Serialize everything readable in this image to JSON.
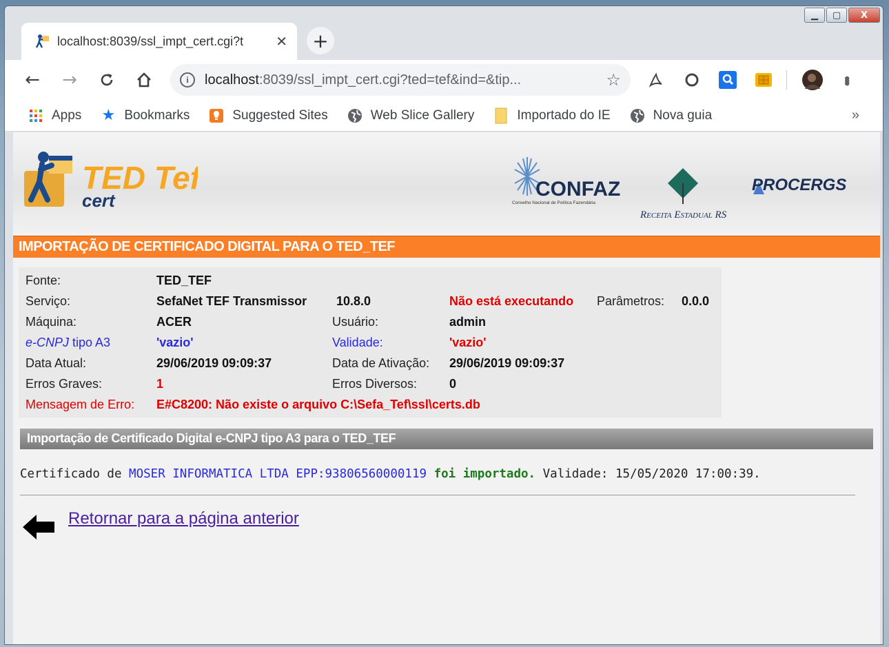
{
  "browser": {
    "tab": {
      "title": "localhost:8039/ssl_impt_cert.cgi?t",
      "close": "✕"
    },
    "new_tab": "+",
    "window_controls": {
      "minimize": "▁",
      "maximize": "▢",
      "close": "X"
    },
    "address_bar": {
      "info": "i",
      "host": "localhost",
      "path": ":8039/ssl_impt_cert.cgi?ted=tef&ind=&tip...",
      "star": "☆"
    },
    "nav": {
      "back": "←",
      "forward": "→",
      "reload": "C",
      "home": "⌂"
    },
    "extensions": [
      "acrobat-icon",
      "opera-icon",
      "search-extension-icon",
      "smartcard-icon",
      "profile-avatar"
    ],
    "menu": "⋮",
    "bookmarks": [
      {
        "label": "Apps",
        "icon": "apps-grid-icon"
      },
      {
        "label": "Bookmarks",
        "icon": "star-icon"
      },
      {
        "label": "Suggested Sites",
        "icon": "suggested-sites-icon"
      },
      {
        "label": "Web Slice Gallery",
        "icon": "globe-icon"
      },
      {
        "label": "Importado do IE",
        "icon": "folder-icon"
      },
      {
        "label": "Nova guia",
        "icon": "globe-icon"
      }
    ],
    "bookmarks_more": "»"
  },
  "page": {
    "banner": {
      "logo_main": "TED Tef",
      "logo_sub": "cert",
      "confaz": "CONFAZ",
      "confaz_sub": "Conselho Nacional de Política Fazendária",
      "receita": "Receita Estadual RS",
      "procergs": "PROCERGS"
    },
    "title": "IMPORTAÇÃO DE CERTIFICADO DIGITAL PARA O TED_TEF",
    "info": {
      "fonte_label": "Fonte:",
      "fonte_value": "TED_TEF",
      "servico_label": "Serviço:",
      "servico_value": "SefaNet TEF Transmissor",
      "versao": "10.8.0",
      "status": "Não está executando",
      "parametros_label": "Parâmetros:",
      "parametros_value": "0.0.0",
      "maquina_label": "Máquina:",
      "maquina_value": "ACER",
      "usuario_label": "Usuário:",
      "usuario_value": "admin",
      "ecnpj_label_italic": "e-CNPJ",
      "ecnpj_label_rest": " tipo A3",
      "ecnpj_value": "'vazio'",
      "validade_label": "Validade:",
      "validade_value": "'vazio'",
      "data_atual_label": "Data Atual:",
      "data_atual_value": "29/06/2019 09:09:37",
      "data_ativacao_label": "Data de Ativação:",
      "data_ativacao_value": "29/06/2019 09:09:37",
      "erros_graves_label": "Erros Graves:",
      "erros_graves_value": "1",
      "erros_diversos_label": "Erros Diversos:",
      "erros_diversos_value": "0",
      "mensagem_label": "Mensagem de Erro:",
      "mensagem_value": "E#C8200: Não existe o arquivo C:\\Sefa_Tef\\ssl\\certs.db"
    },
    "section_title": "Importação de Certificado Digital e-CNPJ tipo A3 para o TED_TEF",
    "result": {
      "prefix": "Certificado de ",
      "company": "MOSER INFORMATICA LTDA EPP:93806560000119",
      "status": "foi importado.",
      "validity": "Validade: 15/05/2020 17:00:39."
    },
    "back_link": "Retornar para a página anterior"
  }
}
